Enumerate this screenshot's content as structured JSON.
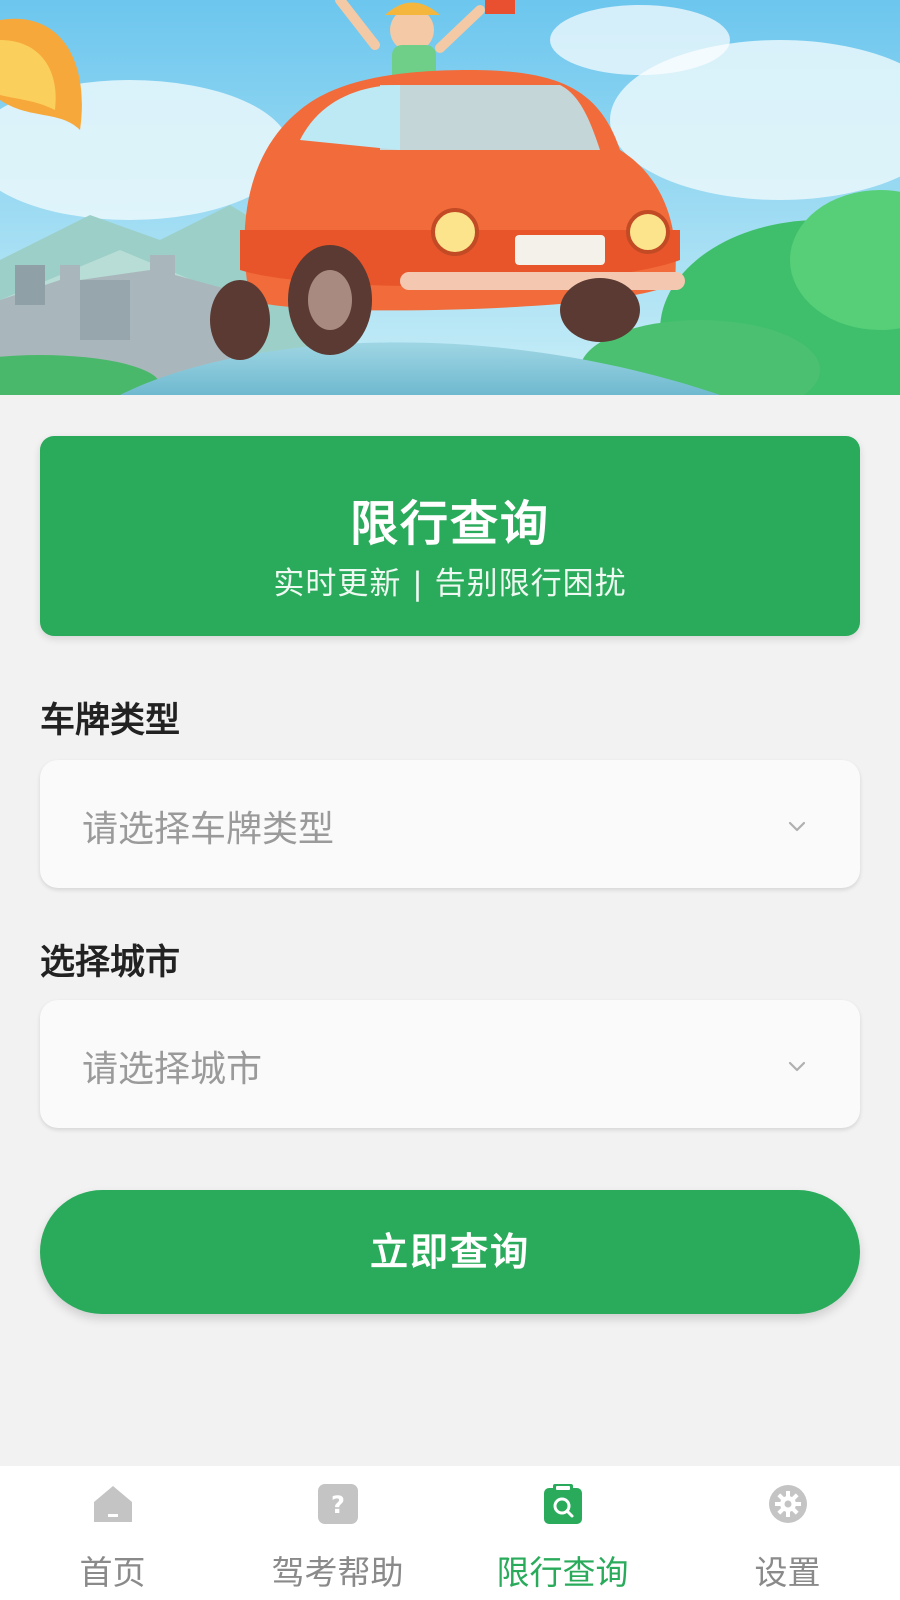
{
  "banner": {
    "title": "限行查询",
    "subtitle": "实时更新 | 告别限行困扰"
  },
  "form": {
    "plate_type": {
      "label": "车牌类型",
      "placeholder": "请选择车牌类型"
    },
    "city": {
      "label": "选择城市",
      "placeholder": "请选择城市"
    },
    "submit_label": "立即查询"
  },
  "tabbar": {
    "items": [
      {
        "label": "首页",
        "icon": "home-icon",
        "active": false
      },
      {
        "label": "驾考帮助",
        "icon": "help-icon",
        "active": false
      },
      {
        "label": "限行查询",
        "icon": "restriction-search-icon",
        "active": true
      },
      {
        "label": "设置",
        "icon": "gear-icon",
        "active": false
      }
    ]
  },
  "colors": {
    "accent": "#2aab5b",
    "inactive": "#8a8a8a",
    "page_background": "#f2f2f2"
  }
}
